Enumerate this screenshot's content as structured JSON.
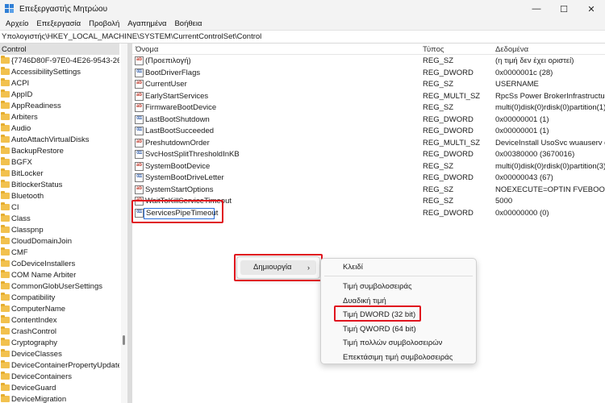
{
  "window": {
    "title": "Επεξεργαστής Μητρώου",
    "minimize": "—",
    "maximize": "☐",
    "close": "✕"
  },
  "menubar": [
    "Αρχείο",
    "Επεξεργασία",
    "Προβολή",
    "Αγαπημένα",
    "Βοήθεια"
  ],
  "address": "Υπολογιστής\\HKEY_LOCAL_MACHINE\\SYSTEM\\CurrentControlSet\\Control",
  "tree": {
    "items": [
      "Control",
      "{7746D80F-97E0-4E26-9543-26B4",
      "AccessibilitySettings",
      "ACPI",
      "AppID",
      "AppReadiness",
      "Arbiters",
      "Audio",
      "AutoAttachVirtualDisks",
      "BackupRestore",
      "BGFX",
      "BitLocker",
      "BitlockerStatus",
      "Bluetooth",
      "CI",
      "Class",
      "Classpnp",
      "CloudDomainJoin",
      "CMF",
      "CoDeviceInstallers",
      "COM Name Arbiter",
      "CommonGlobUserSettings",
      "Compatibility",
      "ComputerName",
      "ContentIndex",
      "CrashControl",
      "Cryptography",
      "DeviceClasses",
      "DeviceContainerPropertyUpdateEv",
      "DeviceContainers",
      "DeviceGuard",
      "DeviceMigration"
    ]
  },
  "values": {
    "headers": {
      "name": "Όνομα",
      "type": "Τύπος",
      "data": "Δεδομένα"
    },
    "rows": [
      {
        "icon": "ab",
        "name": "(Προεπιλογή)",
        "type": "REG_SZ",
        "data": "(η τιμή δεν έχει οριστεί)"
      },
      {
        "icon": "bin",
        "name": "BootDriverFlags",
        "type": "REG_DWORD",
        "data": "0x0000001c (28)"
      },
      {
        "icon": "ab",
        "name": "CurrentUser",
        "type": "REG_SZ",
        "data": "USERNAME"
      },
      {
        "icon": "ab",
        "name": "EarlyStartServices",
        "type": "REG_MULTI_SZ",
        "data": "RpcSs Power BrokerInfrastructure S"
      },
      {
        "icon": "ab",
        "name": "FirmwareBootDevice",
        "type": "REG_SZ",
        "data": "multi(0)disk(0)rdisk(0)partition(1)"
      },
      {
        "icon": "bin",
        "name": "LastBootShutdown",
        "type": "REG_DWORD",
        "data": "0x00000001 (1)"
      },
      {
        "icon": "bin",
        "name": "LastBootSucceeded",
        "type": "REG_DWORD",
        "data": "0x00000001 (1)"
      },
      {
        "icon": "ab",
        "name": "PreshutdownOrder",
        "type": "REG_MULTI_SZ",
        "data": "DeviceInstall UsoSvc wuauserv dos"
      },
      {
        "icon": "bin",
        "name": "SvcHostSplitThresholdInKB",
        "type": "REG_DWORD",
        "data": "0x00380000 (3670016)"
      },
      {
        "icon": "ab",
        "name": "SystemBootDevice",
        "type": "REG_SZ",
        "data": "multi(0)disk(0)rdisk(0)partition(3)"
      },
      {
        "icon": "bin",
        "name": "SystemBootDriveLetter",
        "type": "REG_DWORD",
        "data": "0x00000043 (67)"
      },
      {
        "icon": "ab",
        "name": "SystemStartOptions",
        "type": "REG_SZ",
        "data": " NOEXECUTE=OPTIN  FVEBOOT=2"
      },
      {
        "icon": "ab",
        "name": "WaitToKillServiceTimeout",
        "type": "REG_SZ",
        "data": "5000"
      },
      {
        "icon": "bin",
        "name": "",
        "type": "REG_DWORD",
        "data": "0x00000000 (0)"
      }
    ],
    "rename_value": "ServicesPipeTimeout"
  },
  "context_menu": {
    "new_label": "Δημιουργία",
    "new_arrow": "›",
    "submenu": [
      "Κλειδί",
      "Τιμή συμβολοσειράς",
      "Δυαδική τιμή",
      "Τιμή DWORD (32 bit)",
      "Τιμή QWORD (64 bit)",
      "Τιμή πολλών συμβολοσειρών",
      "Επεκτάσιμη τιμή συμβολοσειράς"
    ]
  }
}
